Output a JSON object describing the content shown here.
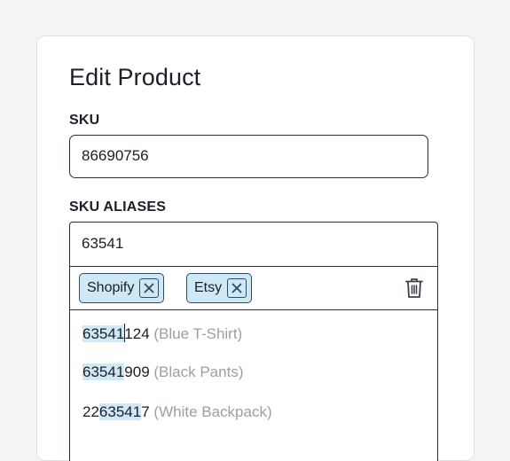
{
  "form": {
    "title": "Edit Product",
    "sku_label": "SKU",
    "sku_value": "86690756",
    "aliases_label": "SKU ALIASES",
    "aliases_input_value": "63541"
  },
  "chips": [
    {
      "label": "Shopify",
      "icon": "close-icon"
    },
    {
      "label": "Etsy",
      "icon": "close-icon"
    }
  ],
  "toolbar": {
    "delete_icon": "trash-icon"
  },
  "options": [
    {
      "pre": "",
      "match": "63541",
      "post": "124",
      "desc": "(Blue T-Shirt)"
    },
    {
      "pre": "",
      "match": "63541",
      "post": "909",
      "desc": "(Black Pants)"
    },
    {
      "pre": "22",
      "match": "63541",
      "post": "7",
      "desc": "(White Backpack)"
    }
  ],
  "colors": {
    "highlight": "#cfe8f5",
    "border": "#2b2f36",
    "muted_text": "#9aa0a8"
  }
}
